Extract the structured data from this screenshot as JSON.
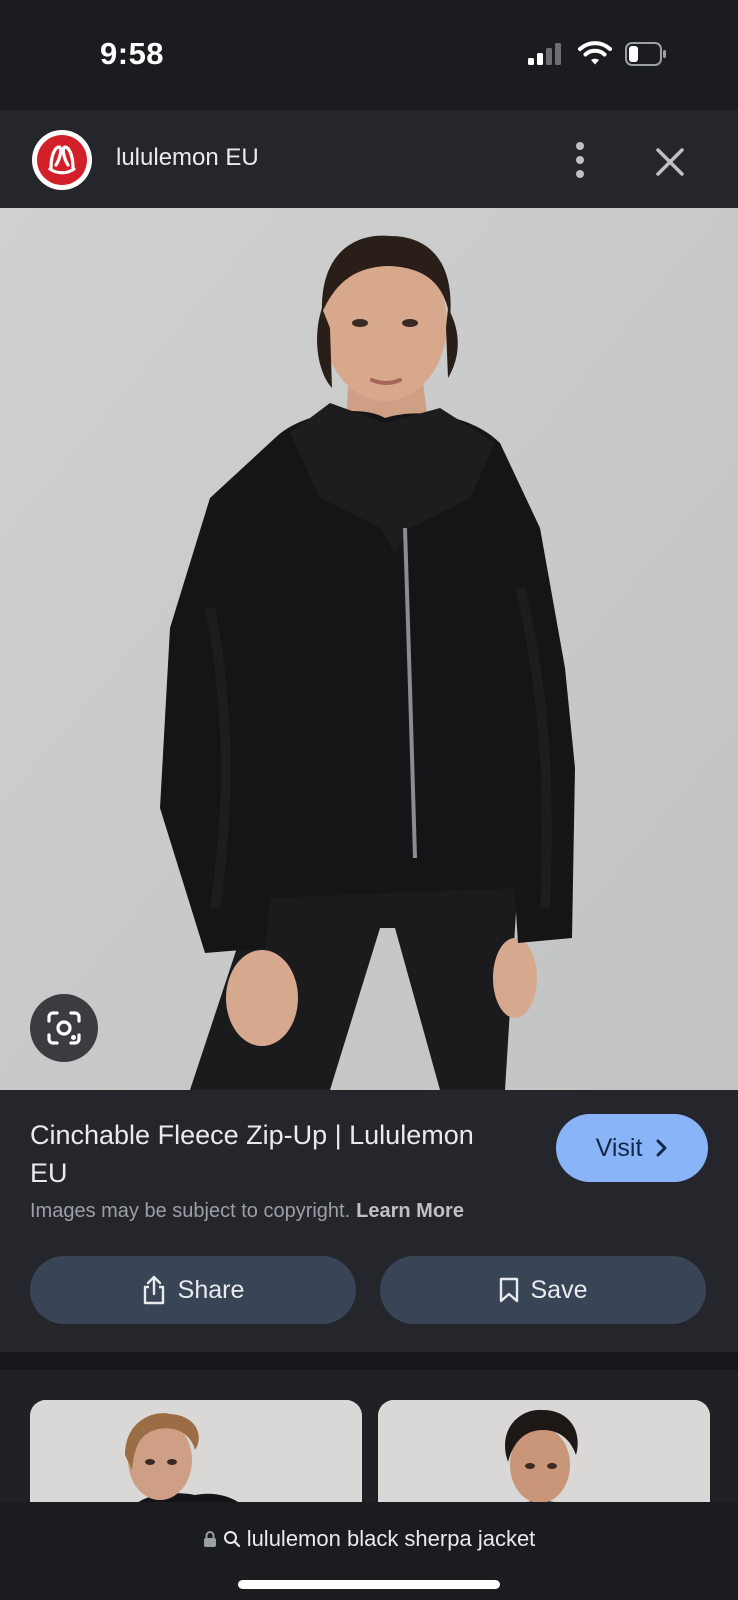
{
  "status_bar": {
    "time": "9:58",
    "signal_icon": "cellular-signal-icon",
    "wifi_icon": "wifi-icon",
    "battery_icon": "battery-icon",
    "battery_level": 0.25
  },
  "header": {
    "site_name": "lululemon EU",
    "logo_icon": "lululemon-logo-icon",
    "more_icon": "more-vertical-icon",
    "close_icon": "close-icon"
  },
  "image": {
    "lens_icon": "google-lens-icon"
  },
  "info": {
    "title": "Cinchable Fleece Zip-Up | Lululemon EU",
    "visit_label": "Visit",
    "copyright_text": "Images may be subject to copyright.",
    "learn_more_label": "Learn More",
    "share_label": "Share",
    "save_label": "Save"
  },
  "bottom": {
    "url_text": "lululemon black sherpa jacket",
    "lock_icon": "lock-icon",
    "search_icon": "search-icon"
  },
  "colors": {
    "accent": "#8ab4f8",
    "button_bg": "#394457",
    "panel_bg": "#24262b",
    "brand_red": "#d31f29"
  }
}
